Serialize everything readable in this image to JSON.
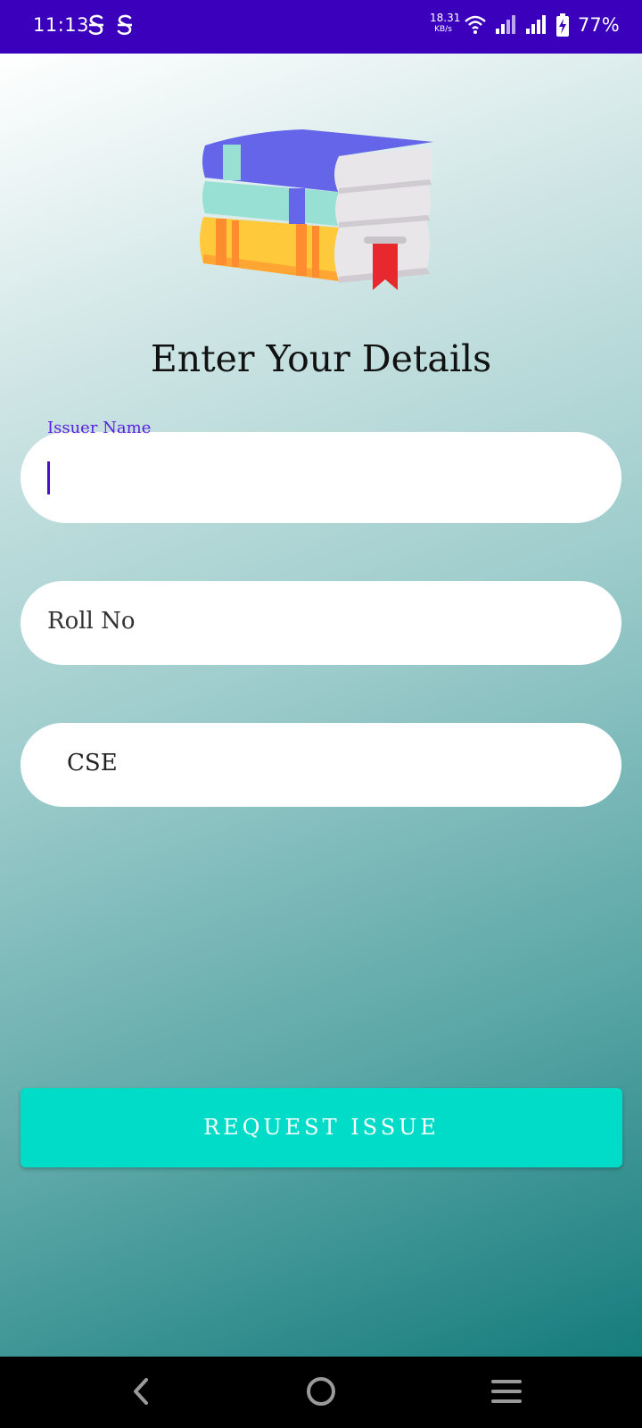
{
  "status_bar": {
    "time": "11:13",
    "notification_icons": [
      "s-icon",
      "s-icon"
    ],
    "net_speed_value": "18.31",
    "net_speed_unit": "KB/s",
    "battery": "77%",
    "background": "#3a00bb"
  },
  "header": {
    "title": "Enter Your Details",
    "illustration": "books-stack-icon"
  },
  "form": {
    "issuer_name_label": "Issuer Name",
    "issuer_name_value": "",
    "roll_placeholder": "Roll No",
    "department_value": "CSE"
  },
  "actions": {
    "request_label": "REQUEST ISSUE",
    "accent": "#00dcc8"
  },
  "nav_bar": {
    "back": "back-icon",
    "home": "home-icon",
    "menu": "menu-icon"
  }
}
